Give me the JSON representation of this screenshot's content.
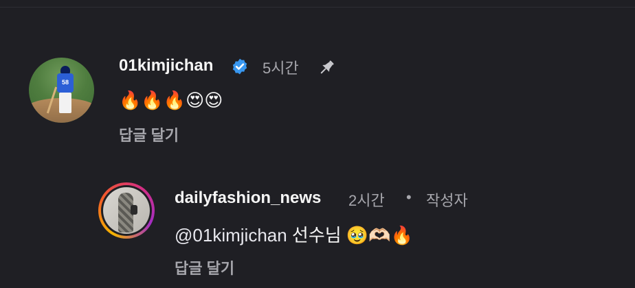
{
  "comments": [
    {
      "username": "01kimjichan",
      "verified": true,
      "time": "5시간",
      "pinned": true,
      "text": "🔥🔥🔥😍😍",
      "reply_label": "답글 달기",
      "avatar_jersey_number": "58"
    },
    {
      "username": "dailyfashion_news",
      "time": "2시간",
      "separator": "•",
      "author_badge": "작성자",
      "mention_prefix": "@",
      "mention": "01kimjichan",
      "text": " 선수님 🥹🫶🏻🔥",
      "reply_label": "답글 달기"
    }
  ],
  "colors": {
    "background": "#1f1f24",
    "text_primary": "#f5f5f5",
    "text_secondary": "#a7a7ad",
    "verified_blue": "#3897f0"
  }
}
